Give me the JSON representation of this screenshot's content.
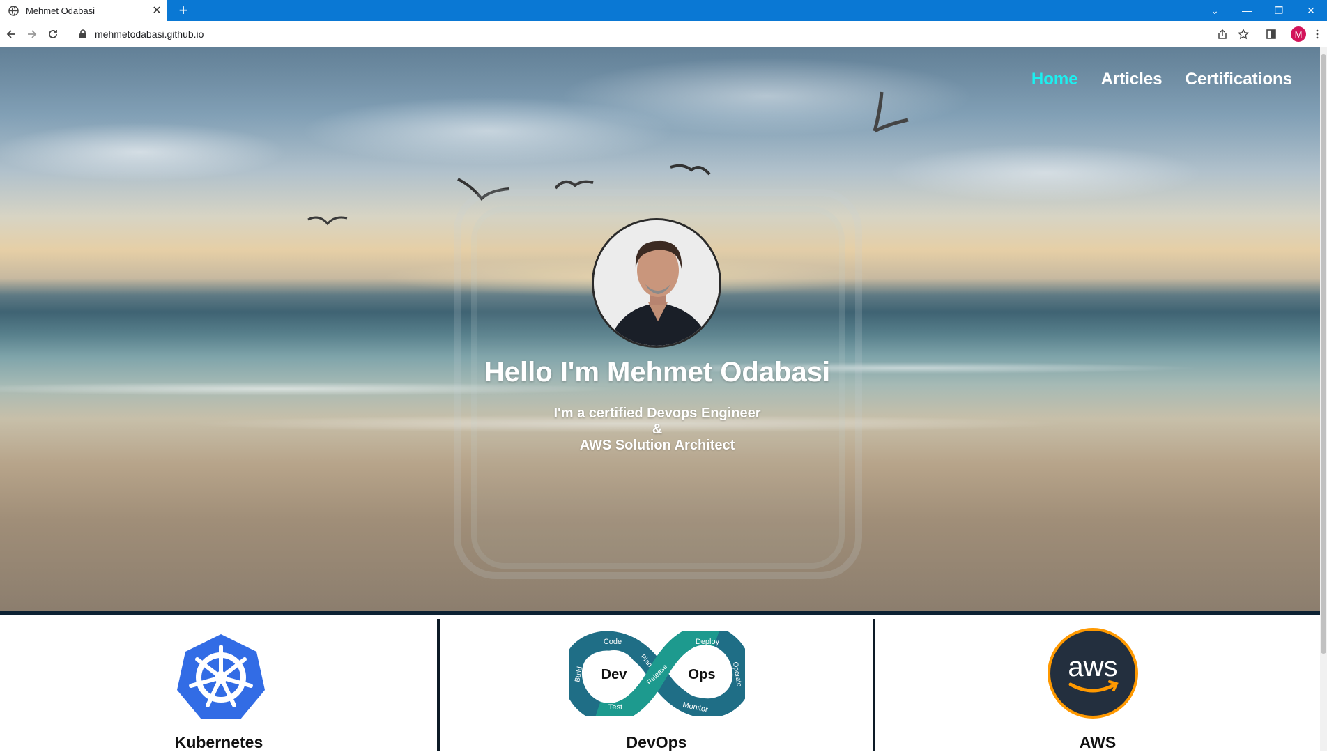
{
  "browser": {
    "tab_title": "Mehmet Odabasi",
    "new_tab": "+",
    "tab_close": "✕",
    "url": "mehmetodabasi.github.io",
    "profile_initial": "M",
    "window_controls": {
      "dropdown": "⌄",
      "minimize": "—",
      "restore": "❐",
      "close": "✕"
    }
  },
  "nav": {
    "items": [
      {
        "label": "Home",
        "active": true
      },
      {
        "label": "Articles",
        "active": false
      },
      {
        "label": "Certifications",
        "active": false
      }
    ],
    "active_color": "#1cf0f0"
  },
  "hero": {
    "title": "Hello I'm Mehmet Odabasi",
    "subtitle_line1": "I'm a certified Devops Engineer",
    "subtitle_line2": "&",
    "subtitle_line3": "AWS Solution Architect"
  },
  "skills": [
    {
      "label": "Kubernetes",
      "icon": "kubernetes-logo-icon",
      "color": "#326ce5"
    },
    {
      "label": "DevOps",
      "icon": "devops-infinity-logo-icon",
      "color": "#1f8a8a"
    },
    {
      "label": "AWS",
      "icon": "aws-logo-icon",
      "color": "#ff9900"
    }
  ],
  "devops_logo": {
    "left_word": "Dev",
    "right_word": "Ops",
    "segments": [
      "Code",
      "Plan",
      "Release",
      "Deploy",
      "Operate",
      "Monitor",
      "Test",
      "Build"
    ]
  },
  "aws_logo": {
    "text": "aws"
  }
}
